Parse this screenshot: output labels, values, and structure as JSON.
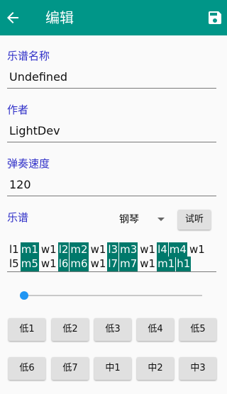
{
  "appbar": {
    "title": "编辑",
    "back_icon": "arrow-left-icon",
    "save_icon": "save-icon"
  },
  "form": {
    "name_label": "乐谱名称",
    "name_value": "Undefined",
    "author_label": "作者",
    "author_value": "LightDev",
    "speed_label": "弹奏速度",
    "speed_value": "120"
  },
  "score": {
    "label": "乐谱",
    "instrument": "钢琴",
    "listen_label": "试听",
    "line1": [
      {
        "t": "l1",
        "h": false
      },
      {
        "t": "m1",
        "h": true
      },
      {
        "t": "w1",
        "h": false
      },
      {
        "t": "l2",
        "h": true
      },
      {
        "t": "m2",
        "h": true
      },
      {
        "t": "w1",
        "h": false
      },
      {
        "t": "l3",
        "h": true
      },
      {
        "t": "m3",
        "h": true
      },
      {
        "t": "w1",
        "h": false
      },
      {
        "t": "l4",
        "h": true
      },
      {
        "t": "m4",
        "h": true
      },
      {
        "t": "w1",
        "h": false
      }
    ],
    "line2": [
      {
        "t": "l5",
        "h": false
      },
      {
        "t": "m5",
        "h": true
      },
      {
        "t": "w1",
        "h": false
      },
      {
        "t": "l6",
        "h": true
      },
      {
        "t": "m6",
        "h": true
      },
      {
        "t": "w1",
        "h": false
      },
      {
        "t": "l7",
        "h": true
      },
      {
        "t": "m7",
        "h": true
      },
      {
        "t": "w1",
        "h": false
      },
      {
        "t": "m1",
        "h": true
      },
      {
        "t": "h1",
        "h": true
      }
    ]
  },
  "slider": {
    "value_fraction": 0
  },
  "keys": {
    "row1": [
      "低1",
      "低2",
      "低3",
      "低4",
      "低5"
    ],
    "row2": [
      "低6",
      "低7",
      "中1",
      "中2",
      "中3"
    ]
  },
  "colors": {
    "primary": "#009688",
    "note_highlight": "#00796b",
    "label": "#3030c8",
    "accent": "#2196f3"
  }
}
